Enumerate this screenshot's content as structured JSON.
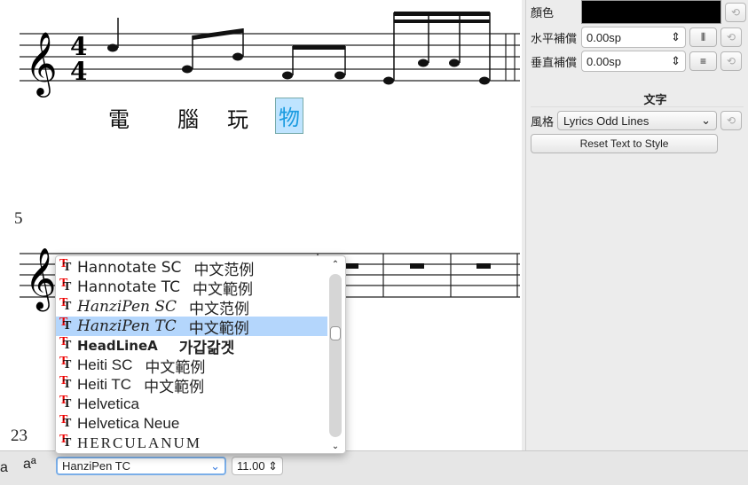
{
  "score": {
    "time_signature": [
      "4",
      "4"
    ],
    "lyrics": [
      "電",
      "腦",
      "玩",
      "物"
    ],
    "selected_lyric_index": 3,
    "measure_numbers": [
      "5",
      "23"
    ]
  },
  "inspector": {
    "color_label": "顏色",
    "color_value": "#000000",
    "h_offset_label": "水平補償",
    "h_offset_value": "0.00sp",
    "v_offset_label": "垂直補償",
    "v_offset_value": "0.00sp",
    "section_title": "文字",
    "style_label": "風格",
    "style_value": "Lyrics Odd Lines",
    "reset_button": "Reset Text to Style"
  },
  "font_list": {
    "items": [
      {
        "name": "Hannotate SC",
        "sample": "中文范例"
      },
      {
        "name": "Hannotate TC",
        "sample": "中文範例"
      },
      {
        "name": "HanziPen SC",
        "sample": "中文范例"
      },
      {
        "name": "HanziPen TC",
        "sample": "中文範例",
        "selected": true
      },
      {
        "name": "HeadLineA",
        "sample": "가갑갊겟"
      },
      {
        "name": "Heiti SC",
        "sample": "中文範例"
      },
      {
        "name": "Heiti TC",
        "sample": "中文範例"
      },
      {
        "name": "Helvetica",
        "sample": ""
      },
      {
        "name": "Helvetica Neue",
        "sample": ""
      },
      {
        "name": "HERCULANUM",
        "sample": ""
      }
    ],
    "scroll_fraction": 0.35
  },
  "toolbar": {
    "subscript_label": "a",
    "superscript_label": "aª",
    "font_value": "HanziPen TC",
    "size_value": "11.00"
  }
}
